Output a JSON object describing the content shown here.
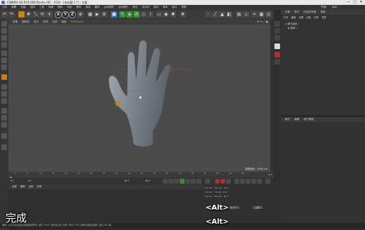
{
  "titlebar": {
    "title": "CINEMA 4D R19.068 Studio (RC - R19) - [未标题 1 *] - 主要",
    "minimize": "—",
    "maximize": "□",
    "close": "✕"
  },
  "menubar": {
    "items": [
      "文件",
      "编辑",
      "创建",
      "选择",
      "工具",
      "网格",
      "捕捉",
      "动画",
      "模拟",
      "渲染",
      "雕刻",
      "运动跟踪",
      "运动图形",
      "角色",
      "流水线",
      "插件",
      "脚本",
      "窗口",
      "帮助"
    ],
    "layout_label": "界面:",
    "layout_value": "启动"
  },
  "toolbar": {
    "axis_x": "X",
    "axis_y": "Y",
    "axis_z": "Z"
  },
  "viewport_menu": {
    "items": [
      "查看",
      "摄像机",
      "显示",
      "选项",
      "过滤",
      "面板"
    ],
    "prorender": "ProRender"
  },
  "viewport": {
    "grid_label": "网格间距 : 1000 cm"
  },
  "object_manager": {
    "tabs": [
      "对象",
      "场次",
      "内容浏览器",
      "构造"
    ],
    "menu": [
      "文件",
      "编辑",
      "查看",
      "对象",
      "标签",
      "书签"
    ],
    "items": [
      "细分曲面",
      "融球"
    ]
  },
  "attribute_manager": {
    "tabs": [
      "模式",
      "编辑",
      "用户数据"
    ]
  },
  "timeline": {
    "ticks": [
      "0",
      "5",
      "10",
      "15",
      "20",
      "25",
      "30",
      "35",
      "40",
      "45",
      "50",
      "55",
      "60",
      "65",
      "70",
      "75",
      "80",
      "85",
      "90"
    ],
    "frame_end_label": "0 F"
  },
  "transport": {
    "start_field": "0 F",
    "current_field": "0 F",
    "end_field": "90 F",
    "end_field2": "90 F"
  },
  "materials": {
    "menu": [
      "创建",
      "编辑",
      "功能",
      "纹理"
    ]
  },
  "coordinates": {
    "rows": [
      {
        "a": "X",
        "av": "0 cm",
        "b": "X",
        "bv": "0 cm",
        "c": "H",
        "cv": "0 °"
      },
      {
        "a": "Y",
        "av": "0 cm",
        "b": "Y",
        "bv": "0 cm",
        "c": "P",
        "cv": "0 °"
      },
      {
        "a": "Z",
        "av": "0 cm",
        "b": "Z",
        "bv": "0 cm",
        "c": "B",
        "cv": "0 °"
      }
    ],
    "mode": "对象 (相对)",
    "size_mode": "绝对尺寸",
    "apply": "应用"
  },
  "statusbar": {
    "text": "融球: 点击并拖动鼠标调整融球物体; 按住 SHIFT 键增加/减少选择; 按住 CTRL 键移动/缩放/旋转; 按住 ALT 键..."
  },
  "overlay": {
    "done": "完成",
    "alt1": "<Alt>",
    "alt2": "<Alt>"
  },
  "colors": {
    "accent": "#c67d14",
    "viewport_bg": "#4b4b4b",
    "panel_bg": "#333333"
  }
}
